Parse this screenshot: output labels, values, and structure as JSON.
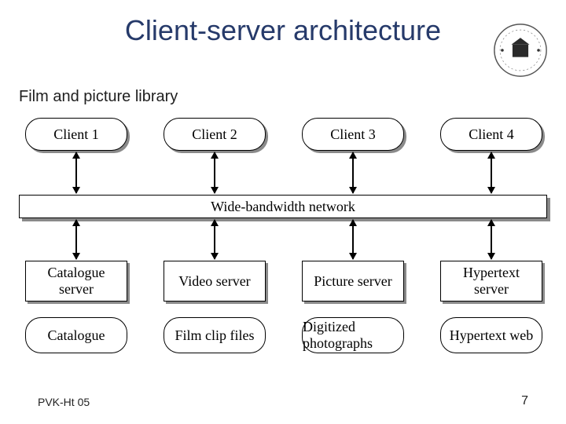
{
  "title": "Client-server architecture",
  "subtitle": "Film and picture library",
  "clients": [
    "Client 1",
    "Client 2",
    "Client 3",
    "Client 4"
  ],
  "network_label": "Wide-bandwidth network",
  "servers": [
    "Catalogue server",
    "Video server",
    "Picture server",
    "Hypertext server"
  ],
  "stores": [
    "Catalogue",
    "Film clip files",
    "Digitized photographs",
    "Hypertext web"
  ],
  "footer": {
    "left": "PVK-Ht 05",
    "page": "7"
  }
}
